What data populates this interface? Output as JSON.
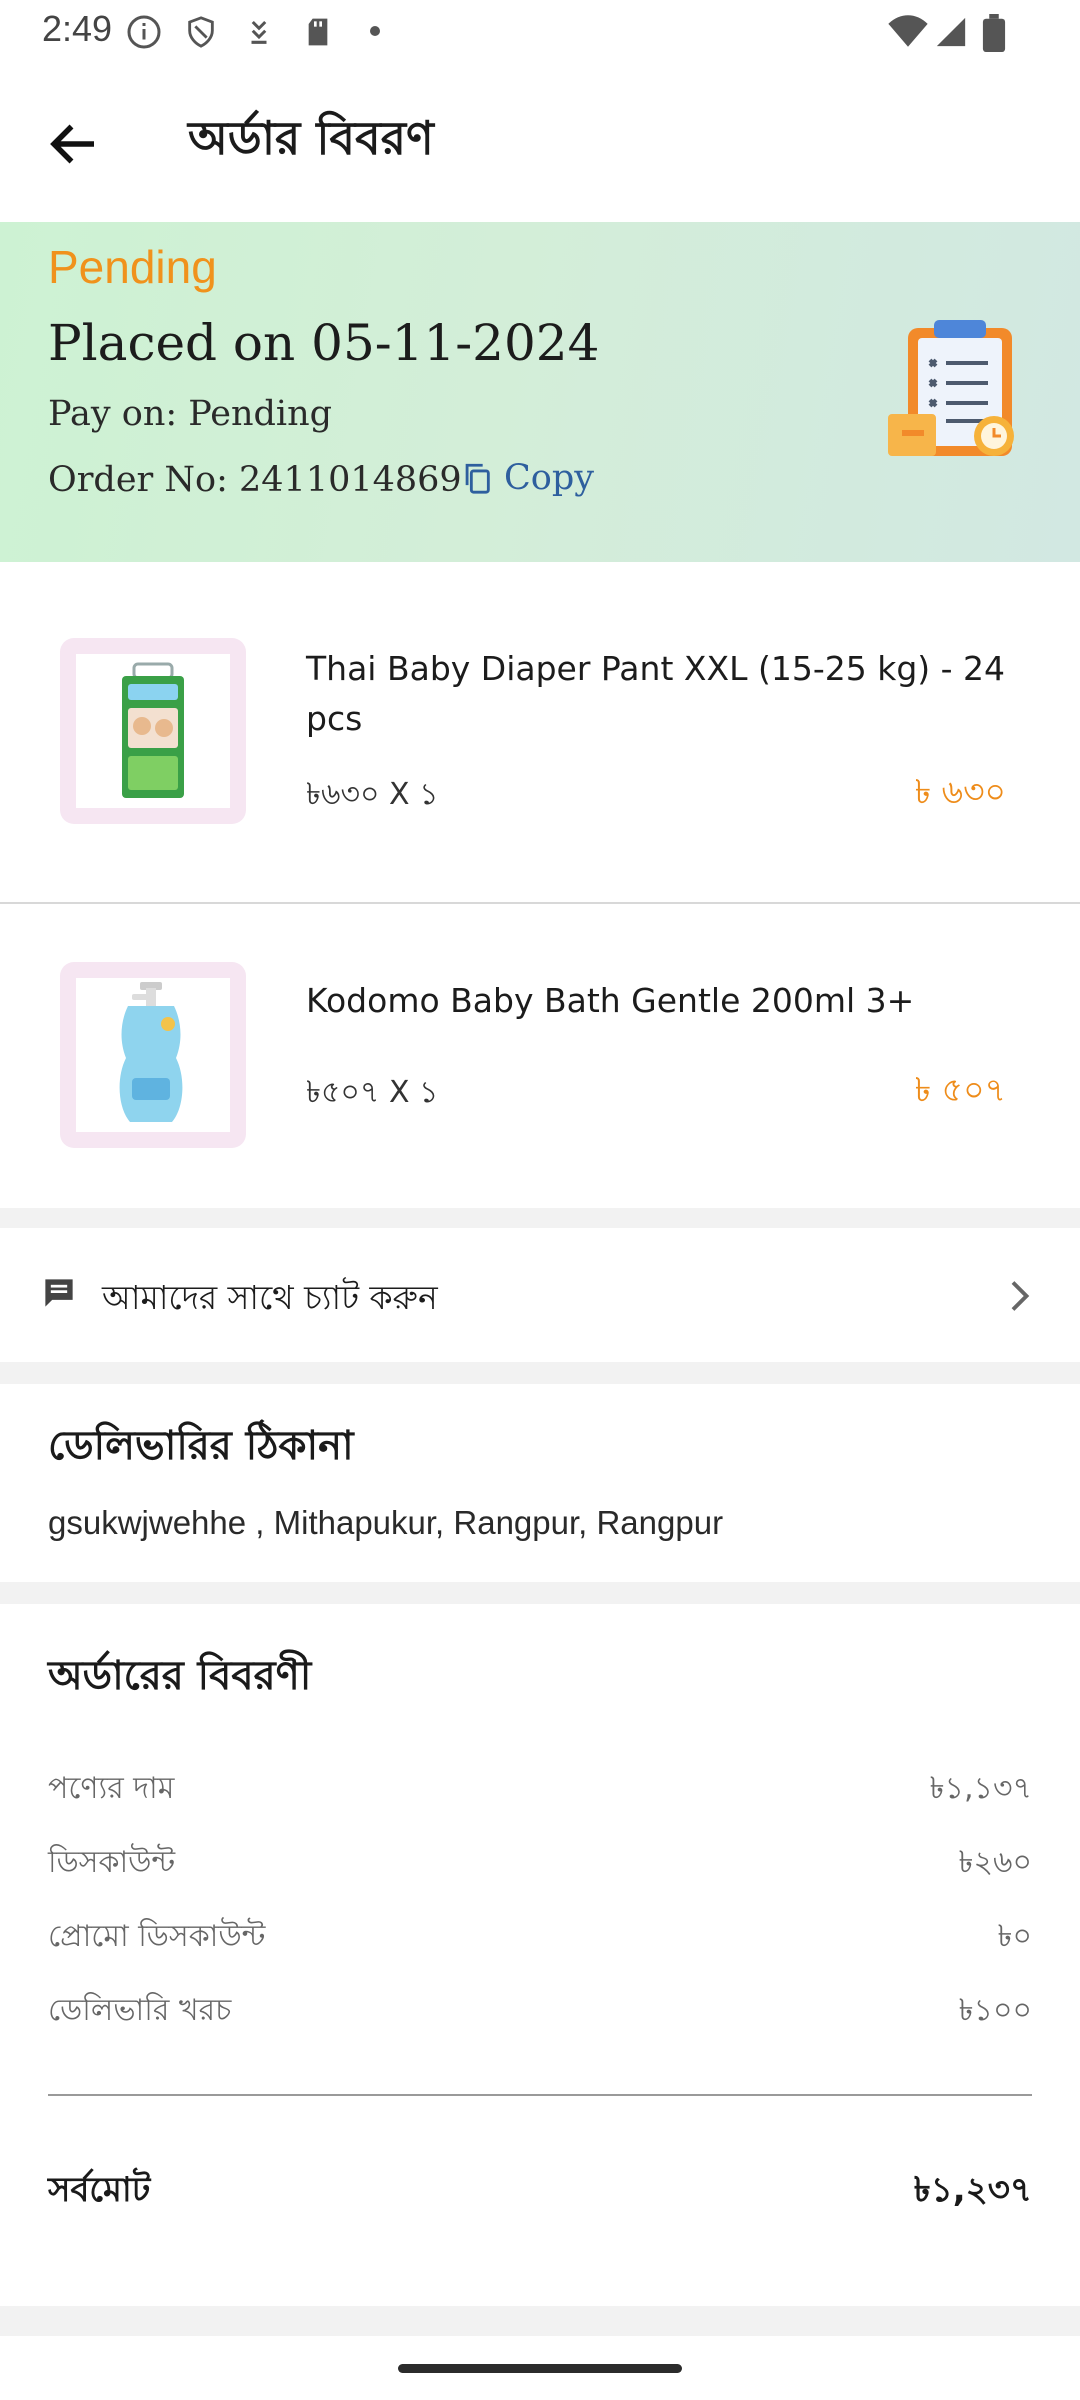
{
  "status_bar": {
    "time": "2:49"
  },
  "app_bar": {
    "title": "অর্ডার বিবরণ"
  },
  "order": {
    "status": "Pending",
    "placed": "Placed on 05-11-2024",
    "pay_on": "Pay on: Pending",
    "order_no": "Order No: 2411014869",
    "copy_label": "Copy"
  },
  "items": [
    {
      "name": "Thai Baby Diaper Pant XXL (15-25 kg) - 24 pcs",
      "qty": "৳৬৩০ X ১",
      "total": "৳ ৬৩০"
    },
    {
      "name": "Kodomo Baby Bath Gentle 200ml 3+",
      "qty": "৳৫০৭ X ১",
      "total": "৳ ৫০৭"
    }
  ],
  "chat": {
    "label": "আমাদের সাথে চ্যাট করুন"
  },
  "delivery": {
    "title": "ডেলিভারির ঠিকানা",
    "address": "gsukwjwehhe , Mithapukur, Rangpur, Rangpur"
  },
  "summary": {
    "title": "অর্ডারের বিবরণী",
    "rows": [
      {
        "label": "পণ্যের দাম",
        "value": "৳১,১৩৭"
      },
      {
        "label": "ডিসকাউন্ট",
        "value": "৳২৬০"
      },
      {
        "label": "প্রোমো ডিসকাউন্ট",
        "value": "৳০"
      },
      {
        "label": "ডেলিভারি খরচ",
        "value": "৳১০০"
      }
    ],
    "total_label": "সর্বমোট",
    "total_value": "৳১,২৩৭"
  },
  "colors": {
    "pending": "#f0921c",
    "price": "#ee8c1a",
    "link": "#2e5f9e"
  }
}
